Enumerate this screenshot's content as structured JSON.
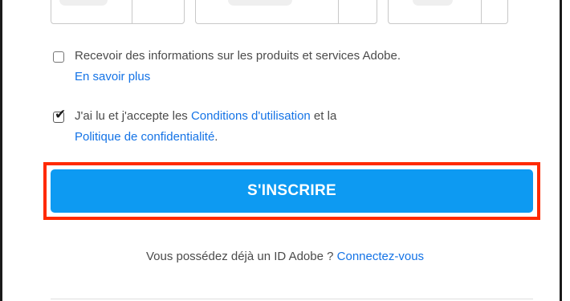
{
  "newsletter": {
    "label": "Recevoir des informations sur les produits et services Adobe.",
    "learn_more": "En savoir plus",
    "checked": false
  },
  "terms": {
    "text_before": "J'ai lu et j'accepte les ",
    "terms_link": "Conditions d'utilisation",
    "text_middle": " et la",
    "privacy_link": "Politique de confidentialité",
    "text_after": ".",
    "checked": true
  },
  "signup_button": {
    "label": "S'INSCRIRE"
  },
  "signin": {
    "prompt": "Vous possédez déjà un ID Adobe ? ",
    "link": "Connectez-vous"
  },
  "colors": {
    "button": "#0d9af2",
    "link": "#1473e6",
    "highlight": "#ff2a00"
  }
}
